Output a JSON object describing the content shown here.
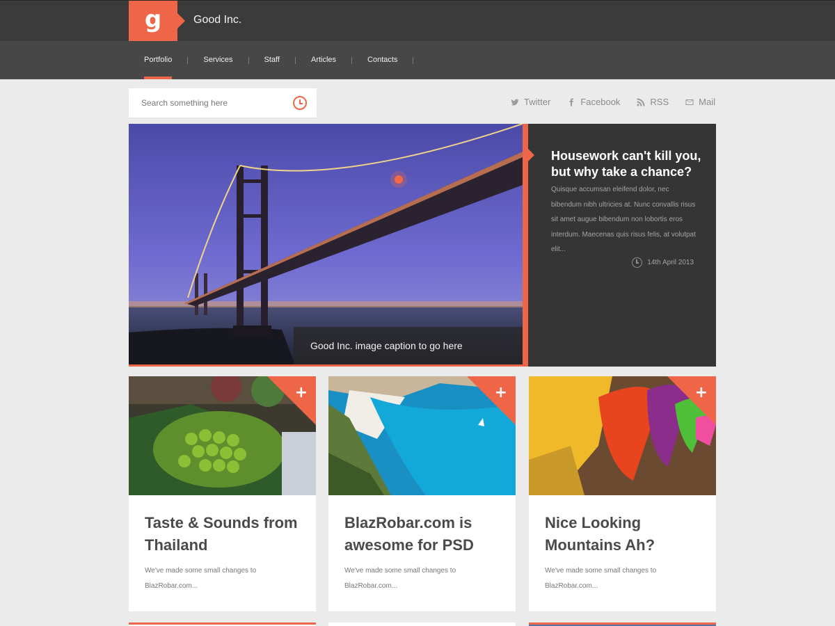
{
  "header": {
    "logo_letter": "g",
    "brand": "Good Inc."
  },
  "nav": {
    "items": [
      {
        "label": "Portfolio",
        "active": true
      },
      {
        "label": "Services",
        "active": false
      },
      {
        "label": "Staff",
        "active": false
      },
      {
        "label": "Articles",
        "active": false
      },
      {
        "label": "Contacts",
        "active": false
      }
    ]
  },
  "search": {
    "placeholder": "Search something here",
    "icon": "clock-icon"
  },
  "social": [
    {
      "label": "Twitter",
      "icon": "twitter-icon"
    },
    {
      "label": "Facebook",
      "icon": "facebook-icon"
    },
    {
      "label": "RSS",
      "icon": "rss-icon"
    },
    {
      "label": "Mail",
      "icon": "mail-icon"
    }
  ],
  "hero": {
    "caption": "Good Inc. image caption to go here",
    "title": "Housework can't kill you, but why take a chance?",
    "text": "Quisque accumsan eleifend dolor, nec bibendum nibh ultricies at. Nunc convallis risus sit amet augue bibendum non lobortis eros interdum. Maecenas quis risus felis, at volutpat elit...",
    "date": "14th April 2013"
  },
  "cards": [
    {
      "title": "Taste & Sounds from Thailand",
      "text": "We've made some small changes to BlazRobar.com..."
    },
    {
      "title": "BlazRobar.com is awesome for PSD",
      "text": "We've made some small changes to BlazRobar.com..."
    },
    {
      "title": "Nice Looking Mountains Ah?",
      "text": "We've made some small changes to BlazRobar.com..."
    }
  ],
  "colors": {
    "accent": "#ef6548",
    "topbar": "#3b3b3b",
    "navbar": "#474747",
    "panel": "#353535"
  }
}
